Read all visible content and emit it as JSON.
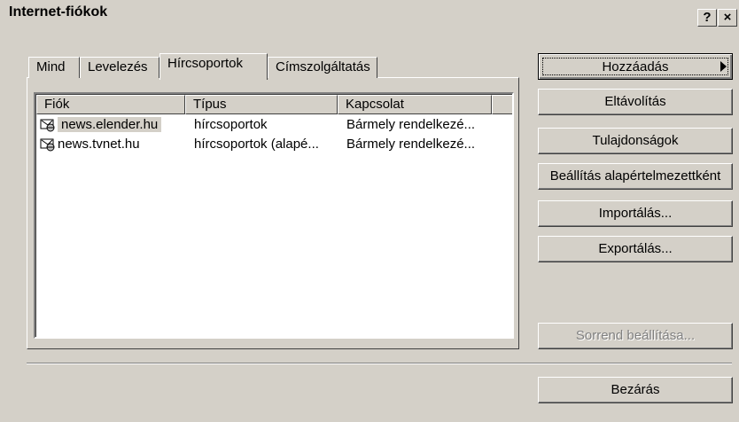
{
  "window": {
    "title": "Internet-fiókok",
    "help_label": "?",
    "close_label": "×"
  },
  "tabs": [
    {
      "label": "Mind"
    },
    {
      "label": "Levelezés"
    },
    {
      "label": "Hírcsoportok"
    },
    {
      "label": "Címszolgáltatás"
    }
  ],
  "accounts_list": {
    "columns": [
      "Fiók",
      "Típus",
      "Kapcsolat"
    ],
    "rows": [
      {
        "account": "news.elender.hu",
        "type": "hírcsoportok",
        "connection": "Bármely rendelkezé...",
        "icon": "news-account-icon",
        "selected": true
      },
      {
        "account": "news.tvnet.hu",
        "type": "hírcsoportok (alapé...",
        "connection": "Bármely rendelkezé...",
        "icon": "news-account-icon",
        "selected": false
      }
    ]
  },
  "buttons": {
    "add_label": "Hozzáadás",
    "remove_label": "Eltávolítás",
    "properties_label": "Tulajdonságok",
    "set_default_label": "Beállítás alapértelmezettként",
    "import_label": "Importálás...",
    "export_label": "Exportálás...",
    "set_order_label": "Sorrend beállítása...",
    "close_label": "Bezárás"
  }
}
